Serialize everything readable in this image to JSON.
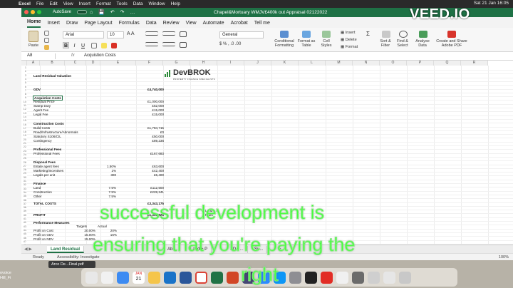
{
  "menubar": {
    "app": "Excel",
    "items": [
      "File",
      "Edit",
      "View",
      "Insert",
      "Format",
      "Tools",
      "Data",
      "Window",
      "Help"
    ],
    "clock": "Sat 21 Jan 16:05"
  },
  "titlebar": {
    "autosave_label": "AutoSave",
    "autosave_state": "OFF",
    "document_title": "Chapel&Mortuary WMJV£400k out Appraisal 02122022"
  },
  "ribbon": {
    "tabs": [
      "Home",
      "Insert",
      "Draw",
      "Page Layout",
      "Formulas",
      "Data",
      "Review",
      "View",
      "Automate",
      "Acrobat",
      "Tell me"
    ],
    "active_tab": "Home",
    "paste_label": "Paste",
    "font_name": "Arial",
    "font_size": "10",
    "bold": "B",
    "italic": "I",
    "underline": "U",
    "number_format": "General",
    "cond_format_label": "Conditional Formatting",
    "format_table_label": "Format as Table",
    "cell_styles_label": "Cell Styles",
    "insert_label": "Insert",
    "delete_label": "Delete",
    "format_label": "Format",
    "sort_filter_label": "Sort & Filter",
    "find_select_label": "Find & Select",
    "analyse_label": "Analyse Data",
    "create_pdf_label": "Create and Share Adobe PDF"
  },
  "formula_bar": {
    "name_box": "A8",
    "fx": "fx",
    "content": "Acquistion Costs"
  },
  "grid": {
    "columns": [
      "A",
      "B",
      "C",
      "D",
      "E",
      "F",
      "G",
      "H",
      "I",
      "J",
      "K",
      "L",
      "M",
      "N",
      "O",
      "P",
      "Q",
      "R"
    ],
    "row_numbers": [
      "1",
      "2",
      "3",
      "4",
      "5",
      "6",
      "7",
      "8",
      "9",
      "10",
      "11",
      "12",
      "13",
      "14",
      "15",
      "16",
      "17",
      "18",
      "19",
      "20",
      "21",
      "22",
      "23",
      "24",
      "25",
      "26",
      "27",
      "28",
      "29",
      "30",
      "31",
      "32",
      "33",
      "34",
      "35",
      "36",
      "37",
      "38",
      "39",
      "40",
      "41",
      "42",
      "43",
      "44",
      "45",
      "46",
      "47",
      "48"
    ],
    "cells": {
      "title": "Land Residual Valuation",
      "gdv_label": "GDV",
      "gdv_value": "£4,740,000",
      "acq_header": "Acquistion Costs",
      "residual_price_label": "Residual Price",
      "residual_price_value": "£1,000,000",
      "stamp_duty_label": "Stamp Duty",
      "stamp_duty_value": "£52,000",
      "agent_fee_label": "Agent Fee",
      "agent_fee_value": "£15,000",
      "legal_fee_label": "Legal Fee",
      "legal_fee_value": "£15,000",
      "construction_header": "Construction Costs",
      "build_costs_label": "Build Costs",
      "build_costs_value": "£1,784,715",
      "road_label": "Road/Infrastructure/Abnormals",
      "road_value": "£0",
      "statutory_label": "Statutory S106/CIL",
      "statutory_value": "£50,000",
      "contingency_label": "Contingency",
      "contingency_value": "£89,236",
      "prof_header": "Professional Fees",
      "prof_label": "Professional Fees",
      "prof_value": "£167,683",
      "disposal_header": "Disposal Fees",
      "estate_label": "Estate agent fees",
      "estate_pct": "1.50%",
      "estate_value": "£63,600",
      "marketing_label": "Marketing/Incentives",
      "marketing_pct": "1%",
      "marketing_value": "£42,400",
      "legals_label": "Legals per unit",
      "legals_qty": "300",
      "legals_value": "£5,400",
      "finance_header": "Finance",
      "land_label": "Land",
      "land_pct": "7.5%",
      "land_value": "£112,500",
      "construction_label": "Construction",
      "construction_pct": "7.5%",
      "construction_value": "£228,241",
      "other_label": "Other",
      "other_pct": "7.5%",
      "total_label": "TOTAL COSTS",
      "total_value": "£3,343,175",
      "profit_label": "PROFIT",
      "profit_value": "£1,396,825",
      "perf_header": "Performance Measures",
      "targets_label": "Targets",
      "actual_label": "Actual",
      "pog_label": "Profit on Cost",
      "pog_target": "20.00%",
      "pog_actual": "20%",
      "pogdv_label": "Profit on GDV",
      "pogdv_target": "15.00%",
      "pogdv_actual": "16%",
      "ponv_label": "Profit on NDV",
      "ponv_target": "15.00%"
    },
    "side_note_a": "Land + P",
    "side_note_b": "Profit"
  },
  "logo": {
    "name": "DevBROK",
    "tagline": "PROPERTY FINANCE SPECIALISTS"
  },
  "sheet_tabs": {
    "tabs": [
      "Land Residual",
      "Ab...",
      "Land + P",
      "SDA ...",
      "Su..."
    ],
    "active": "Land Residual",
    "add": "+"
  },
  "status": {
    "ready": "Ready",
    "accessibility": "Accessibility: Investigate",
    "zoom": "100%"
  },
  "dock": {
    "left_labels": [
      "ovoice",
      "Hill_Fi"
    ],
    "preview_title": "Arco De...Final.pdf",
    "calendar_day": "21",
    "calendar_month": "JAN"
  },
  "overlay": {
    "watermark": "VEED.IO",
    "caption_line1": "successful development is",
    "caption_line2": "ensuring that you're paying the",
    "caption_line3": "right"
  },
  "colors": {
    "excel_green": "#1e7145",
    "caption_green": "#44ff3a"
  }
}
